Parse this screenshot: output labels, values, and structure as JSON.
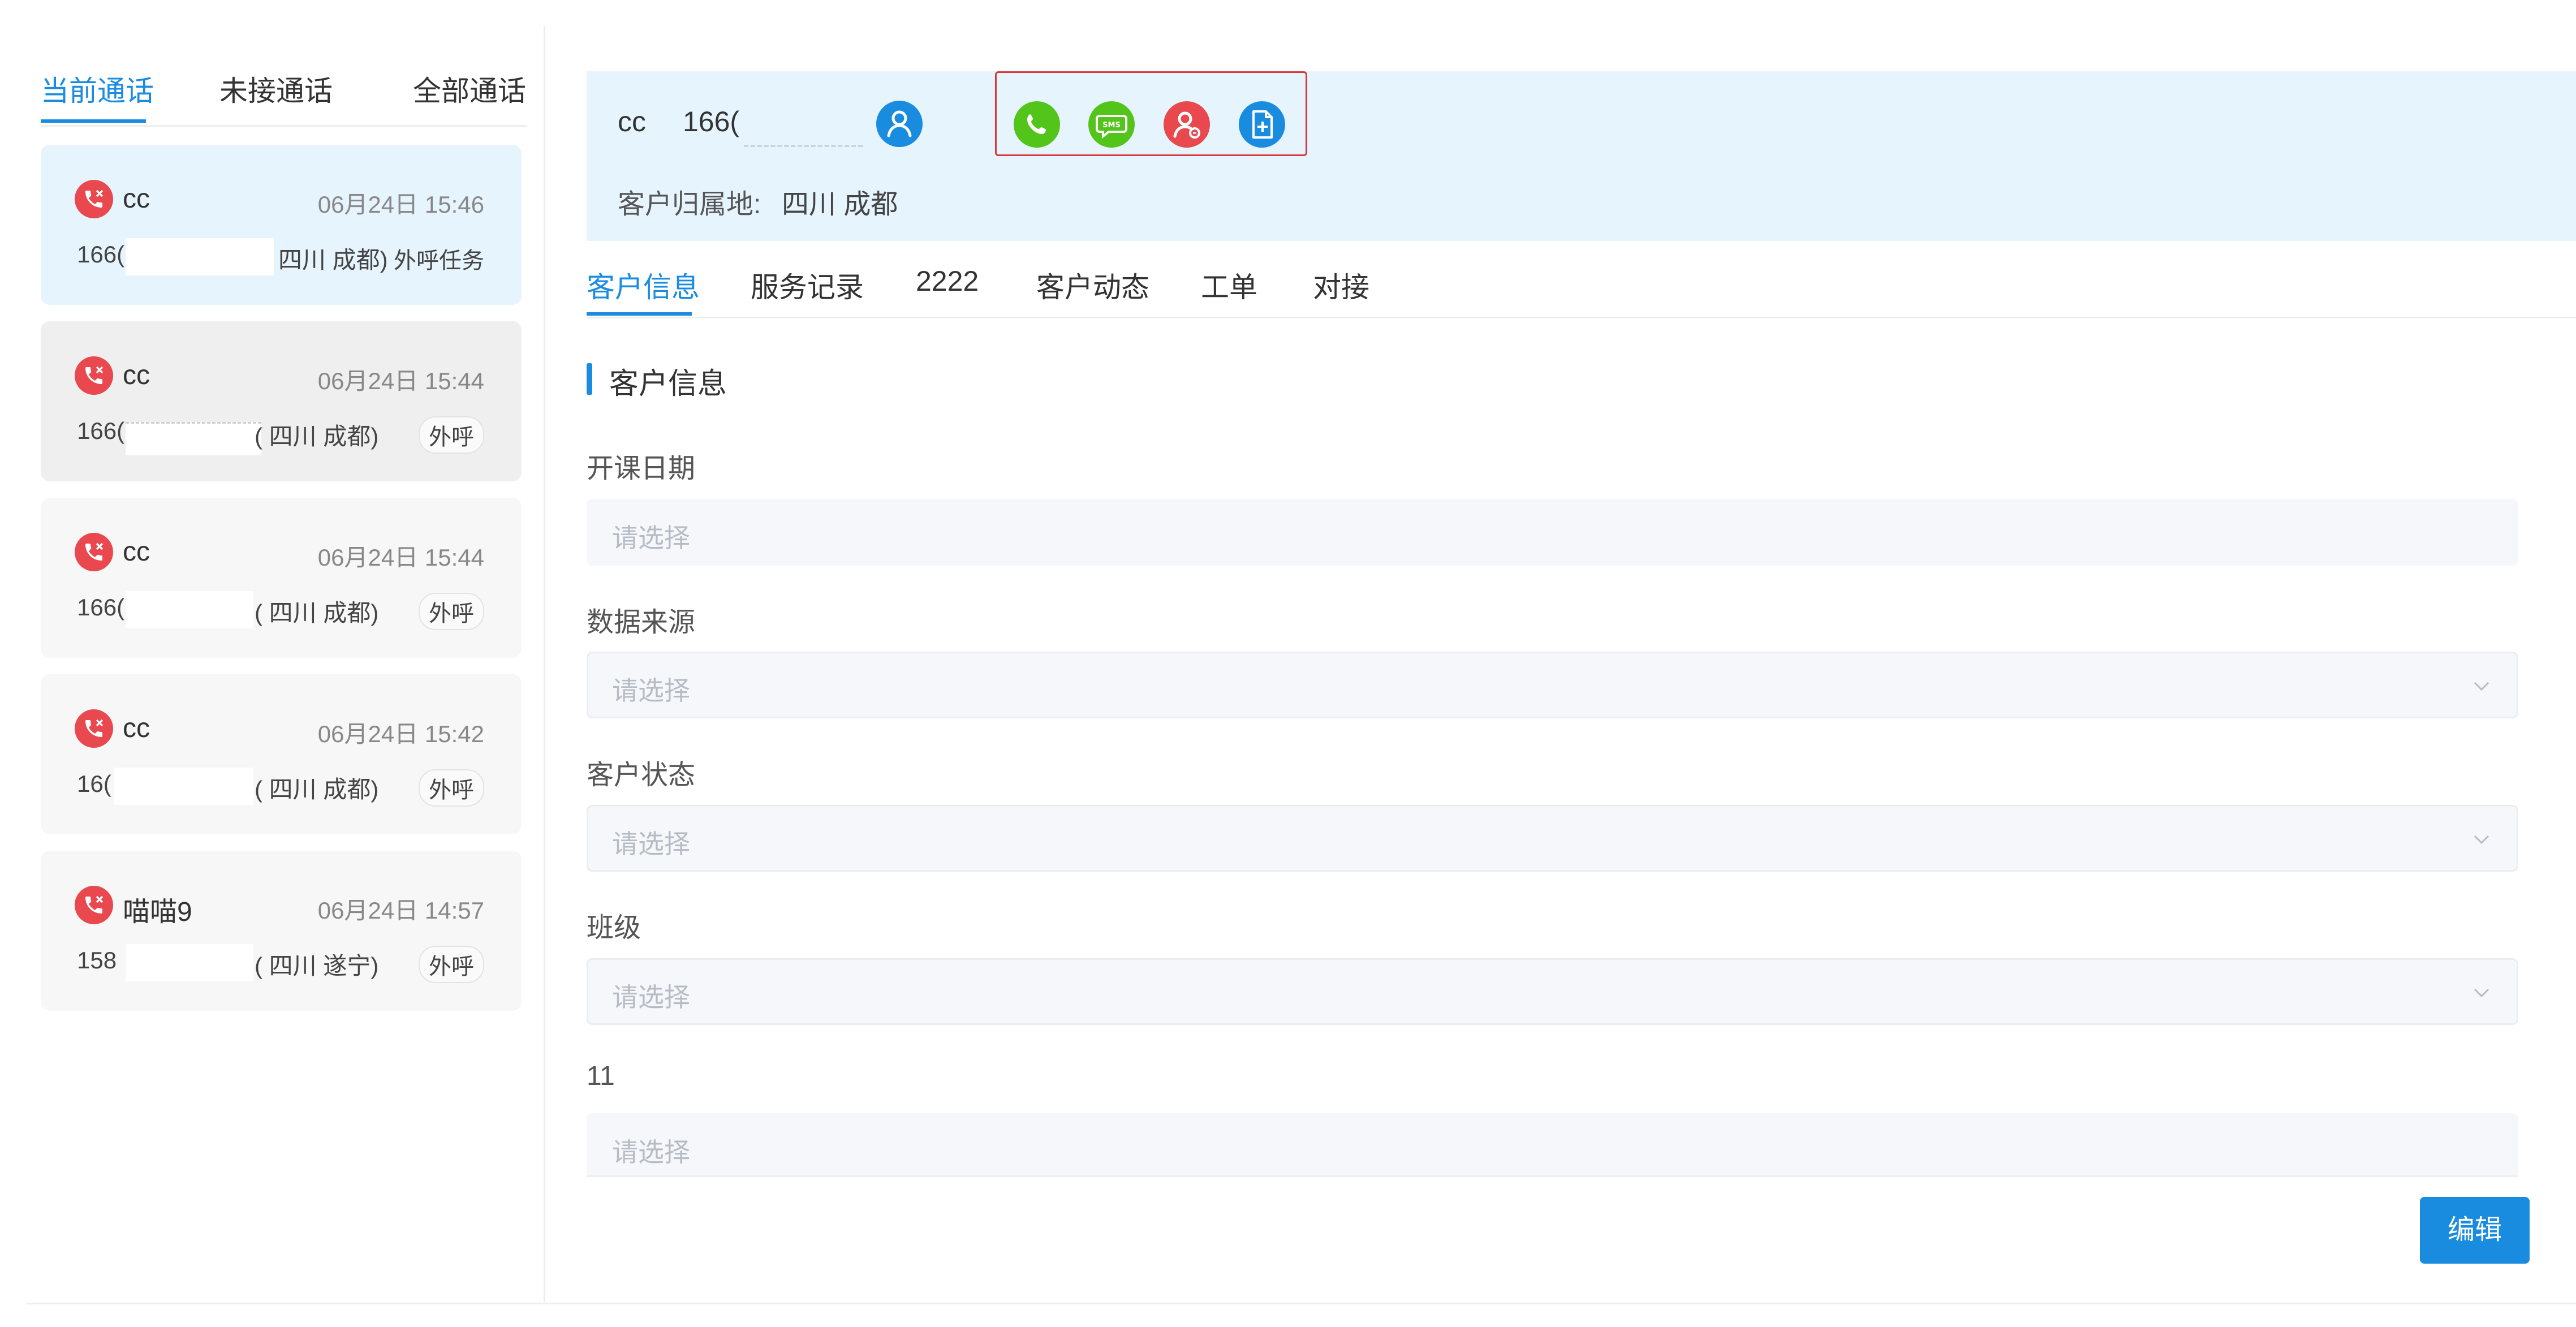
{
  "left_tabs": {
    "current": "当前通话",
    "missed": "未接通话",
    "all": "全部通话"
  },
  "calls": [
    {
      "name": "cc",
      "time": "06月24日 15:46",
      "number_prefix": "166(",
      "location": "四川 成都)",
      "tag": "外呼任务"
    },
    {
      "name": "cc",
      "time": "06月24日 15:44",
      "number_prefix": "166(",
      "location": "( 四川 成都)",
      "tag": "外呼"
    },
    {
      "name": "cc",
      "time": "06月24日 15:44",
      "number_prefix": "166(",
      "location": "( 四川 成都)",
      "tag": "外呼"
    },
    {
      "name": "cc",
      "time": "06月24日 15:42",
      "number_prefix": "16(",
      "location": "( 四川 成都)",
      "tag": "外呼"
    },
    {
      "name": "喵喵9",
      "time": "06月24日 14:57",
      "number_prefix": "158",
      "location": "( 四川 遂宁)",
      "tag": "外呼"
    }
  ],
  "customer": {
    "name": "cc",
    "phone_prefix": "166(",
    "attribution_label": "客户归属地:",
    "attribution_value": "四川 成都"
  },
  "right_tabs": [
    "客户信息",
    "服务记录",
    "2222",
    "客户动态",
    "工单",
    "对接"
  ],
  "section_title": "客户信息",
  "fields": [
    {
      "label": "开课日期",
      "placeholder": "请选择"
    },
    {
      "label": "数据来源",
      "placeholder": "请选择"
    },
    {
      "label": "客户状态",
      "placeholder": "请选择"
    },
    {
      "label": "班级",
      "placeholder": "请选择"
    },
    {
      "label": "11",
      "placeholder": "请选择"
    }
  ],
  "edit_label": "编辑",
  "colors": {
    "accent": "#1a8ce0",
    "call_red": "#e8484e",
    "green": "#52c41a",
    "header_bg": "#e6f4fd"
  }
}
